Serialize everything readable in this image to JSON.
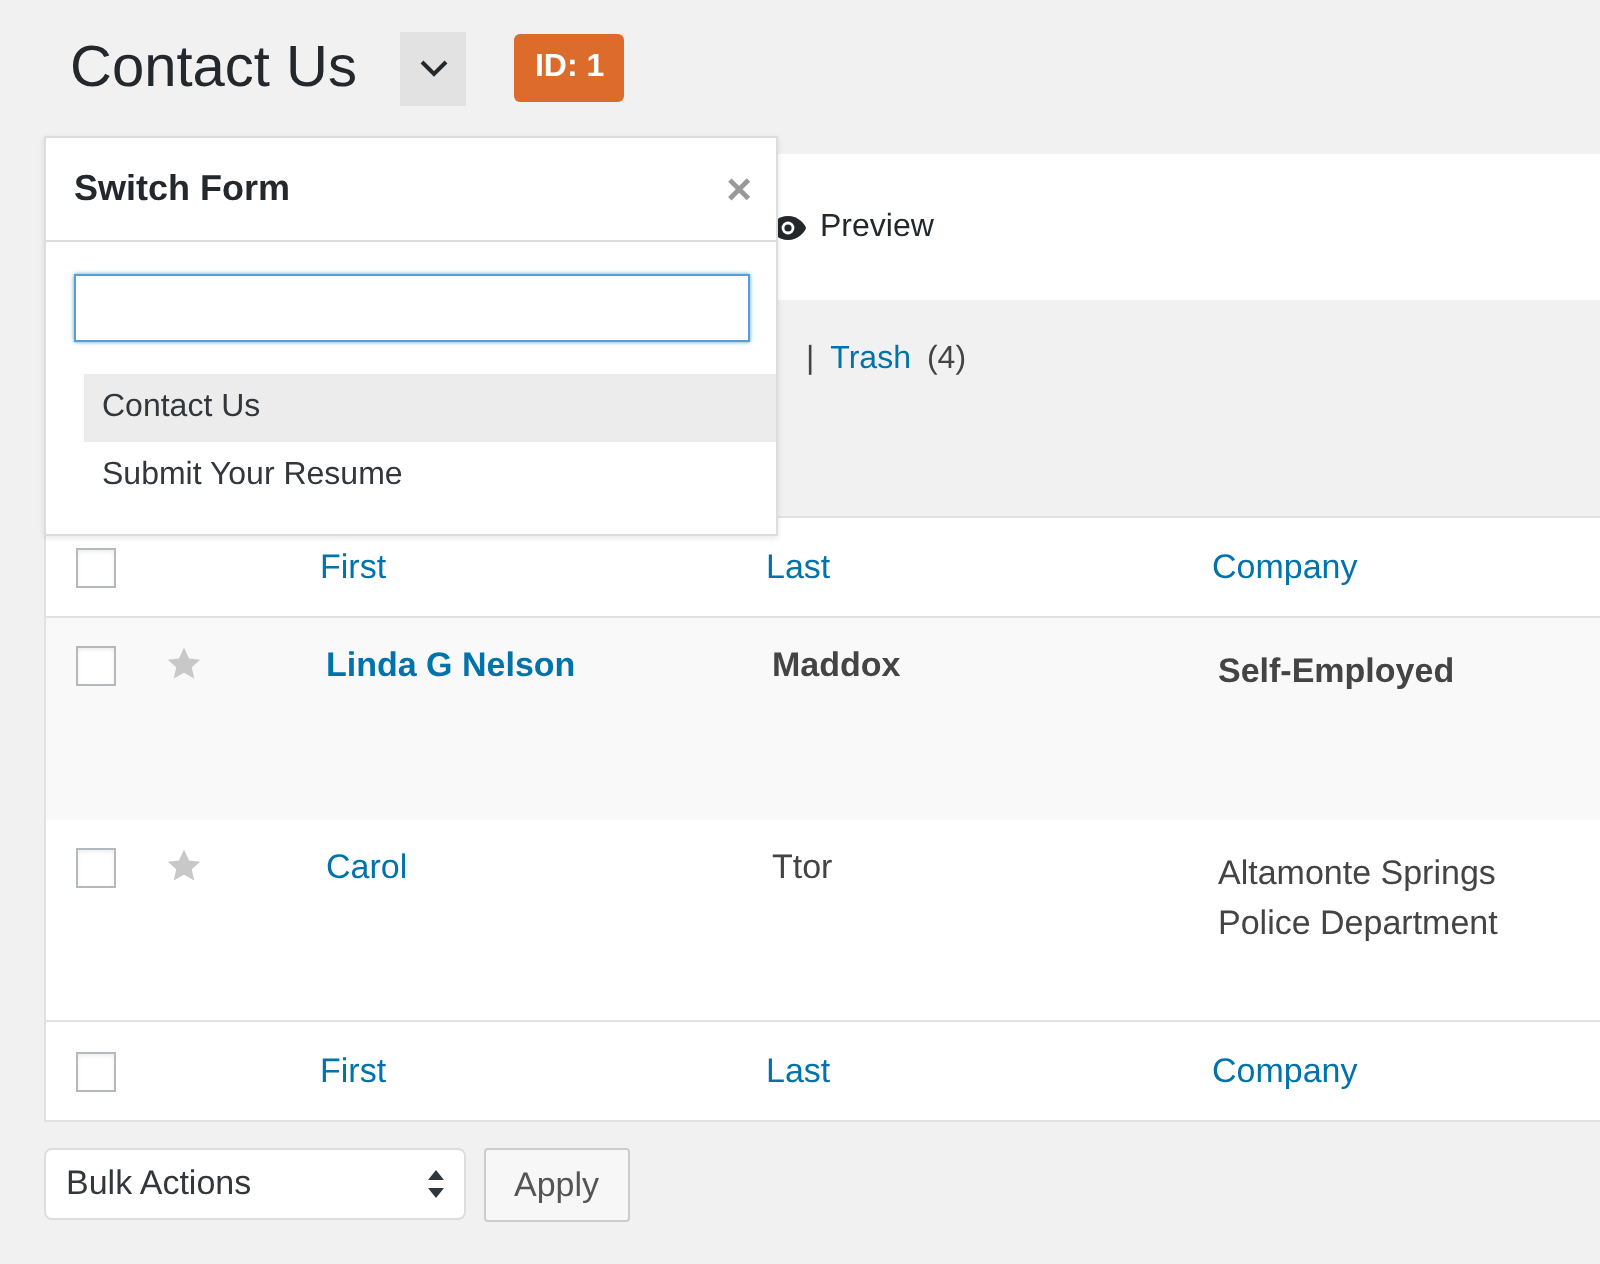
{
  "page_title": "Contact Us",
  "form_id_badge": "ID: 1",
  "toolbar": {
    "preview": "Preview"
  },
  "filters": {
    "separator": "|",
    "trash_label": "Trash",
    "trash_count": "(4)"
  },
  "switch_form": {
    "title": "Switch Form",
    "close": "×",
    "items": [
      {
        "label": "Contact Us",
        "selected": true
      },
      {
        "label": "Submit Your Resume",
        "selected": false
      }
    ]
  },
  "table": {
    "select_all_checked": false,
    "footer_select_all_checked": false,
    "columns": [
      "First",
      "Last",
      "Company"
    ],
    "rows": [
      {
        "checked": false,
        "starred": false,
        "unread": true,
        "first": "Linda G Nelson",
        "last": "Maddox",
        "company": "Self-Employed"
      },
      {
        "checked": false,
        "starred": false,
        "unread": false,
        "first": "Carol",
        "last": "Ttor",
        "company": "Altamonte Springs Police Department"
      }
    ],
    "footer_columns": [
      "First",
      "Last",
      "Company"
    ]
  },
  "bulk_actions": {
    "value": "Bulk Actions",
    "apply": "Apply"
  }
}
